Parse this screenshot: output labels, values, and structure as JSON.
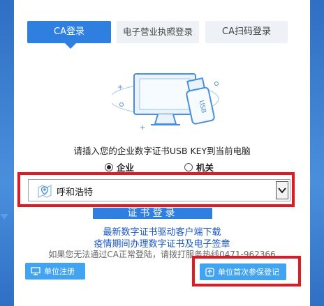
{
  "tabs": [
    {
      "label": "CA登录",
      "active": true
    },
    {
      "label": "电子营业执照登录",
      "active": false
    },
    {
      "label": "CA扫码登录",
      "active": false
    }
  ],
  "prompt": "请插入您的企业数字证书USB KEY到当前电脑",
  "usb_label": "USB",
  "radios": [
    {
      "label": "企业",
      "selected": true
    },
    {
      "label": "机关",
      "selected": false
    }
  ],
  "region_select": {
    "value": "呼和浩特",
    "icon": "map-pin-icon"
  },
  "login_button": "证书登录",
  "links": [
    "最新数字证书驱动客户端下载",
    "疫情期间办理数字证书及电子签章"
  ],
  "tip": "如果您无法通过CA正常登陆，请拨打服务热线0471-962366",
  "buttons": {
    "register": {
      "label": "单位注册",
      "icon": "monitor-icon"
    },
    "first_register": {
      "label": "单位首次参保登记",
      "icon": "upload-icon"
    }
  },
  "colors": {
    "accent": "#2f7fe0",
    "highlight": "#e01a22",
    "link": "#1a56c8"
  }
}
